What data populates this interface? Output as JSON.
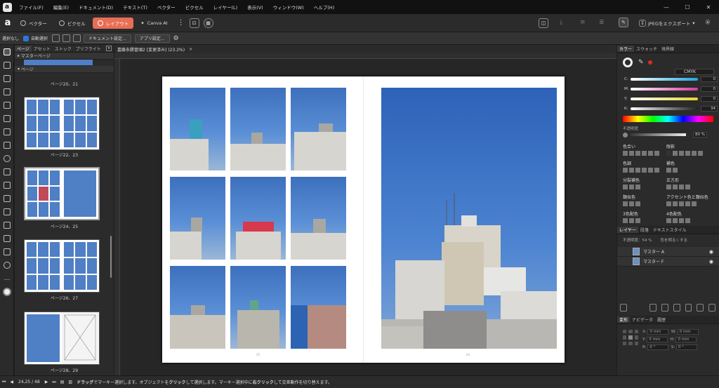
{
  "menu": [
    "ファイル(F)",
    "編集(E)",
    "ドキュメント(D)",
    "テキスト(T)",
    "ベクター",
    "ピクセル",
    "レイヤー(L)",
    "表示(V)",
    "ウィンドウ(W)",
    "ヘルプ(H)"
  ],
  "personas": [
    "ベクター",
    "ピクセル",
    "レイアウト",
    "Canva AI"
  ],
  "export_label": "JPEGをエクスポート",
  "ctx": {
    "no_selection": "選択なし",
    "auto_select": "自動選択",
    "doc_settings": "ドキュメント設定...",
    "app_settings": "アプリ設定..."
  },
  "pages_panel": {
    "tabs": [
      "ページ",
      "アセット",
      "ストック",
      "プリフライト"
    ],
    "master_section": "マスターページ",
    "pages_section": "ページ",
    "spread_labels": [
      "ページ20、21",
      "ページ22、23",
      "ページ24、25",
      "ページ26、27",
      "ページ28、29"
    ]
  },
  "doc_tab": "嘉藤永勝冒頭2 [変更済み] (23.2%)",
  "page_numbers": {
    "left": "25",
    "right": "24"
  },
  "right_panel": {
    "tabs_top": [
      "カラー",
      "スウォッチ",
      "境界線"
    ],
    "color_model": "CMYK",
    "sliders": [
      {
        "label": "C:",
        "value": "0",
        "color": "#2aa8d6"
      },
      {
        "label": "M:",
        "value": "0",
        "color": "#d63fa3"
      },
      {
        "label": "Y:",
        "value": "0",
        "color": "#e6d63a"
      },
      {
        "label": "K:",
        "value": "34",
        "color": "#aaaaaa"
      }
    ],
    "opacity_label": "不透明度",
    "opacity_value": "80 %",
    "swatch_groups": [
      "色合い",
      "陰影",
      "色調",
      "補色",
      "分裂補色",
      "正方形",
      "類似色",
      "アクセント色と類似色",
      "3色配色",
      "4色配色"
    ],
    "tabs_layers": [
      "レイヤー",
      "段落",
      "テキストスタイル"
    ],
    "opacity_mini": "不透明度：54 %",
    "blend": "色を明るくする",
    "layers": [
      "マスター A",
      "マスター F"
    ],
    "tabs_transform": [
      "変形",
      "ナビゲータ",
      "履歴"
    ],
    "transform": {
      "x": "0 mm",
      "y": "0 mm",
      "w": "0 mm",
      "h": "0 mm",
      "r": "0 °",
      "s": "0 °"
    }
  },
  "status": {
    "page": "24,25 / 48",
    "hint_1": "ドラッグ",
    "hint_2": "でマーキー選択します。オブジェクトを",
    "hint_3": "クリック",
    "hint_4": "して選択します。マーキー選択中に",
    "hint_5": "右クリック",
    "hint_6": "して交差動作を切り替えます。"
  }
}
